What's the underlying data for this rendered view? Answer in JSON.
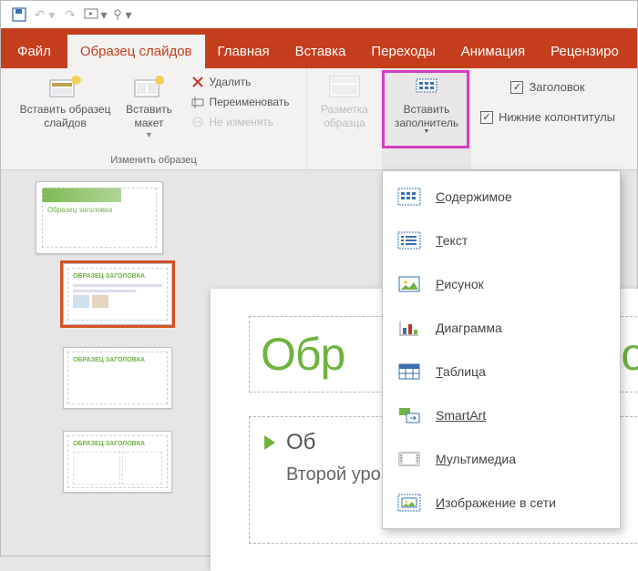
{
  "qat": {
    "save": "save",
    "undo": "undo",
    "redo": "redo",
    "slideshow": "slideshow",
    "touch": "touch"
  },
  "tabs": {
    "file": "Файл",
    "active": "Образец слайдов",
    "home": "Главная",
    "insert": "Вставка",
    "transitions": "Переходы",
    "animation": "Анимация",
    "review": "Рецензиро"
  },
  "ribbon": {
    "group_edit_label": "Изменить образец",
    "insert_slide_master": "Вставить образец слайдов",
    "insert_layout": "Вставить макет",
    "delete": "Удалить",
    "rename": "Переименовать",
    "preserve": "Не изменять",
    "master_layout": "Разметка образца",
    "insert_placeholder": "Вставить заполнитель",
    "chk_title": "Заголовок",
    "chk_footers": "Нижние колонтитулы"
  },
  "dropdown": [
    {
      "key": "content",
      "ul": "С",
      "label": "одержимое"
    },
    {
      "key": "text",
      "ul": "Т",
      "label": "екст"
    },
    {
      "key": "picture",
      "ul": "Р",
      "label": "исунок"
    },
    {
      "key": "chart",
      "ul": "Д",
      "label": "иаграмма"
    },
    {
      "key": "table",
      "ul": "Т",
      "label": "аблица"
    },
    {
      "key": "smartart",
      "ul": "",
      "label": "SmartArt"
    },
    {
      "key": "media",
      "ul": "М",
      "label": "ультимедиа"
    },
    {
      "key": "online_image",
      "ul": "И",
      "label": "зображение в сети"
    }
  ],
  "slide": {
    "title": "Обр",
    "title_suffix": "ло",
    "level1": "Об",
    "level2": "Второй уровень"
  },
  "thumbs": {
    "master_title": "Образец заголовка",
    "layout_title": "ОБРАЗЕЦ ЗАГОЛОВКА"
  },
  "colors": {
    "accent": "#c43e1c",
    "highlight": "#d63cc3",
    "green": "#6fb33f"
  }
}
